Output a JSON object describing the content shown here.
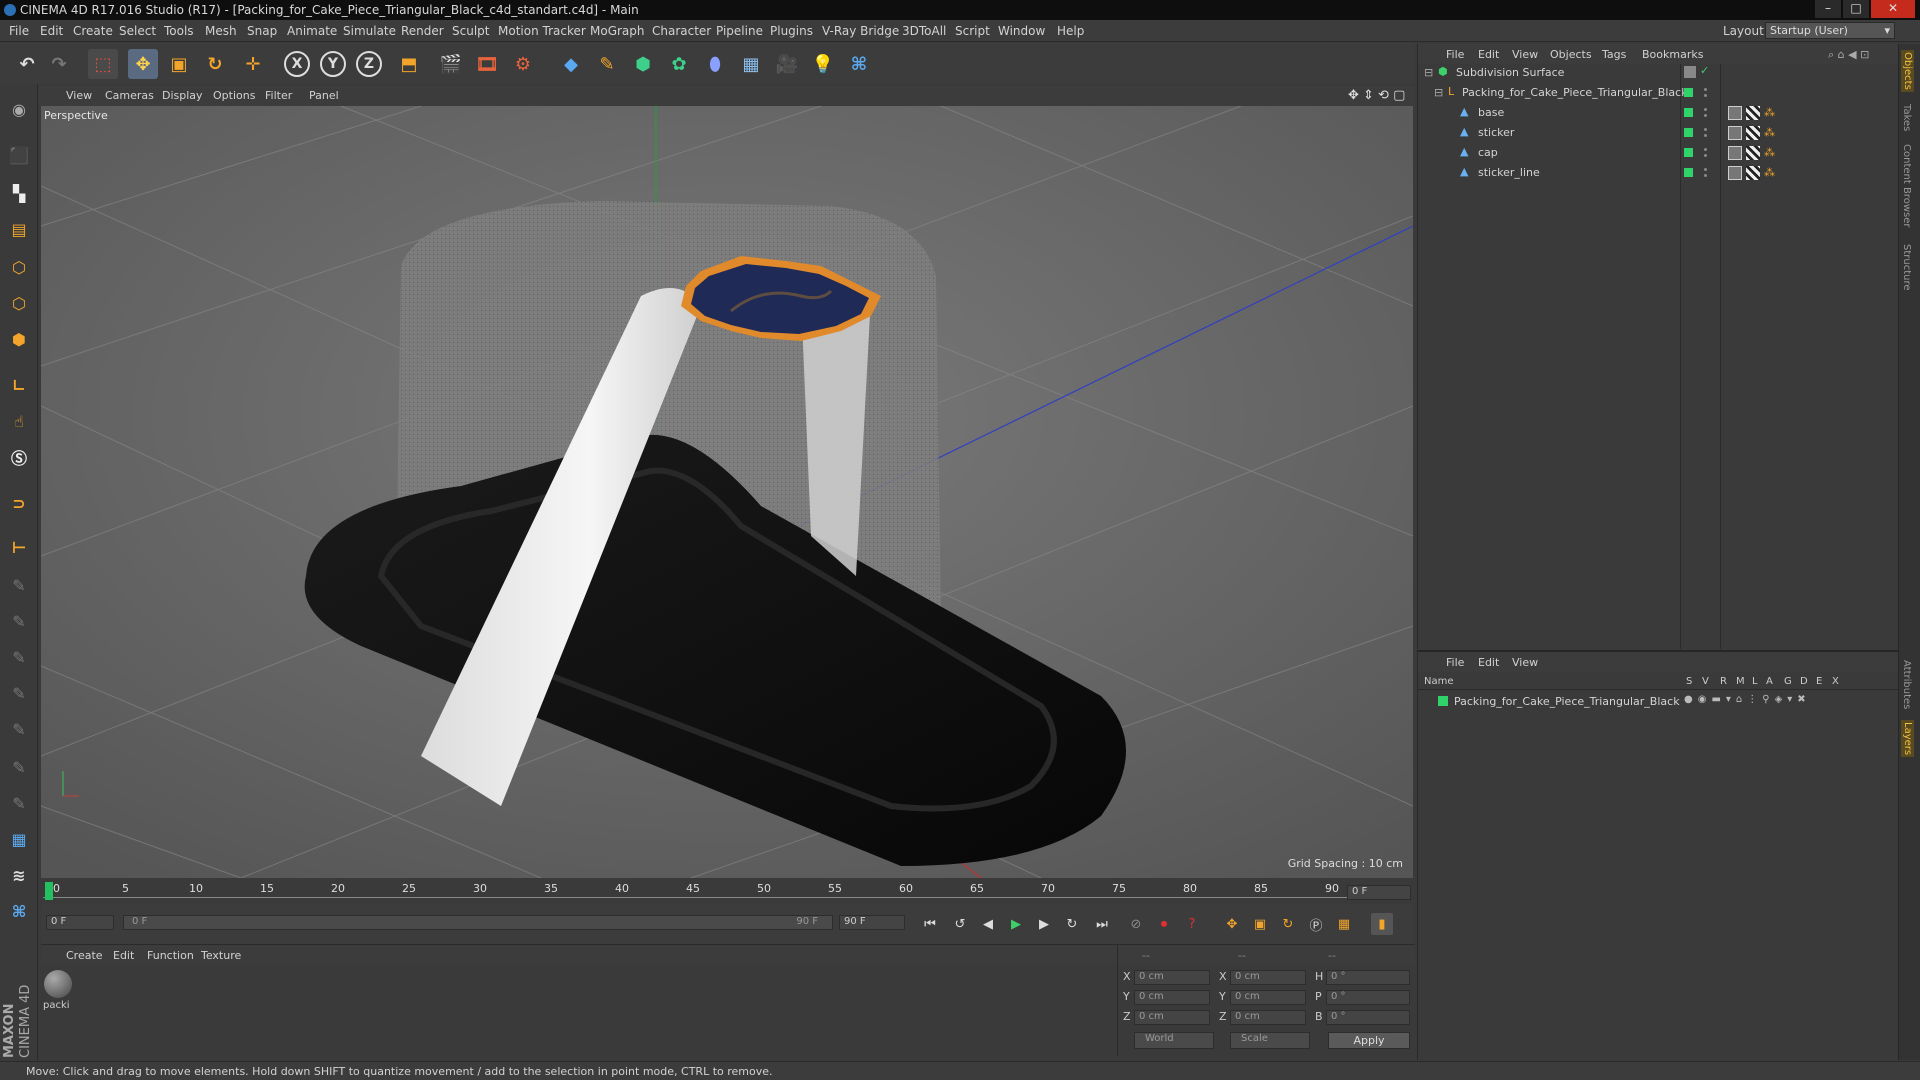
{
  "window": {
    "title": "CINEMA 4D R17.016 Studio (R17) - [Packing_for_Cake_Piece_Triangular_Black_c4d_standart.c4d] - Main",
    "minimize": "–",
    "maximize": "□",
    "close": "✕"
  },
  "menubar": {
    "items": [
      "File",
      "Edit",
      "Create",
      "Select",
      "Tools",
      "Mesh",
      "Snap",
      "Animate",
      "Simulate",
      "Render",
      "Sculpt",
      "Motion Tracker",
      "MoGraph",
      "Character",
      "Pipeline",
      "Plugins",
      "V-Ray Bridge",
      "3DToAll",
      "Script",
      "Window",
      "Help"
    ],
    "layout_label": "Layout:",
    "layout_value": "Startup (User)"
  },
  "viewport": {
    "menu": [
      "View",
      "Cameras",
      "Display",
      "Options",
      "Filter",
      "Panel"
    ],
    "label": "Perspective",
    "grid_spacing": "Grid Spacing : 10 cm"
  },
  "timeline": {
    "ticks": [
      "0",
      "5",
      "10",
      "15",
      "20",
      "25",
      "30",
      "35",
      "40",
      "45",
      "50",
      "55",
      "60",
      "65",
      "70",
      "75",
      "80",
      "85",
      "90"
    ],
    "current_frame": "0 F",
    "start_field": "0 F",
    "range_start": "0 F",
    "range_end": "90 F",
    "end_field": "90 F"
  },
  "materials": {
    "menu": [
      "Create",
      "Edit",
      "Function",
      "Texture"
    ],
    "items": [
      {
        "name": "packi"
      }
    ]
  },
  "coordinates": {
    "header": [
      "--",
      "--",
      "--"
    ],
    "rows": [
      {
        "a": "X",
        "av": "0 cm",
        "b": "X",
        "bv": "0 cm",
        "c": "H",
        "cv": "0 °"
      },
      {
        "a": "Y",
        "av": "0 cm",
        "b": "Y",
        "bv": "0 cm",
        "c": "P",
        "cv": "0 °"
      },
      {
        "a": "Z",
        "av": "0 cm",
        "b": "Z",
        "bv": "0 cm",
        "c": "B",
        "cv": "0 °"
      }
    ],
    "mode": "World",
    "scale": "Scale",
    "apply": "Apply"
  },
  "objects_panel": {
    "menu": [
      "File",
      "Edit",
      "View",
      "Objects",
      "Tags",
      "Bookmarks"
    ],
    "tree": [
      {
        "name": "Subdivision Surface",
        "level": 0
      },
      {
        "name": "Packing_for_Cake_Piece_Triangular_Black",
        "level": 1
      },
      {
        "name": "base",
        "level": 2
      },
      {
        "name": "sticker",
        "level": 2
      },
      {
        "name": "cap",
        "level": 2
      },
      {
        "name": "sticker_line",
        "level": 2
      }
    ]
  },
  "layers_panel": {
    "menu": [
      "File",
      "Edit",
      "View"
    ],
    "columns": [
      "Name",
      "S",
      "V",
      "R",
      "M",
      "L",
      "A",
      "G",
      "D",
      "E",
      "X"
    ],
    "rows": [
      {
        "name": "Packing_for_Cake_Piece_Triangular_Black"
      }
    ]
  },
  "right_tabs": [
    "Objects",
    "Takes",
    "Content Browser",
    "Structure",
    "Attributes",
    "Layers"
  ],
  "status": "Move: Click and drag to move elements. Hold down SHIFT to quantize movement / add to the selection in point mode, CTRL to remove.",
  "brand": {
    "top": "MAXON",
    "bottom": "CINEMA 4D"
  },
  "colors": {
    "accent_green": "#2fd36a",
    "sticker_navy": "#1f2a56",
    "sticker_orange": "#e08a2b",
    "box_black": "#111111"
  }
}
